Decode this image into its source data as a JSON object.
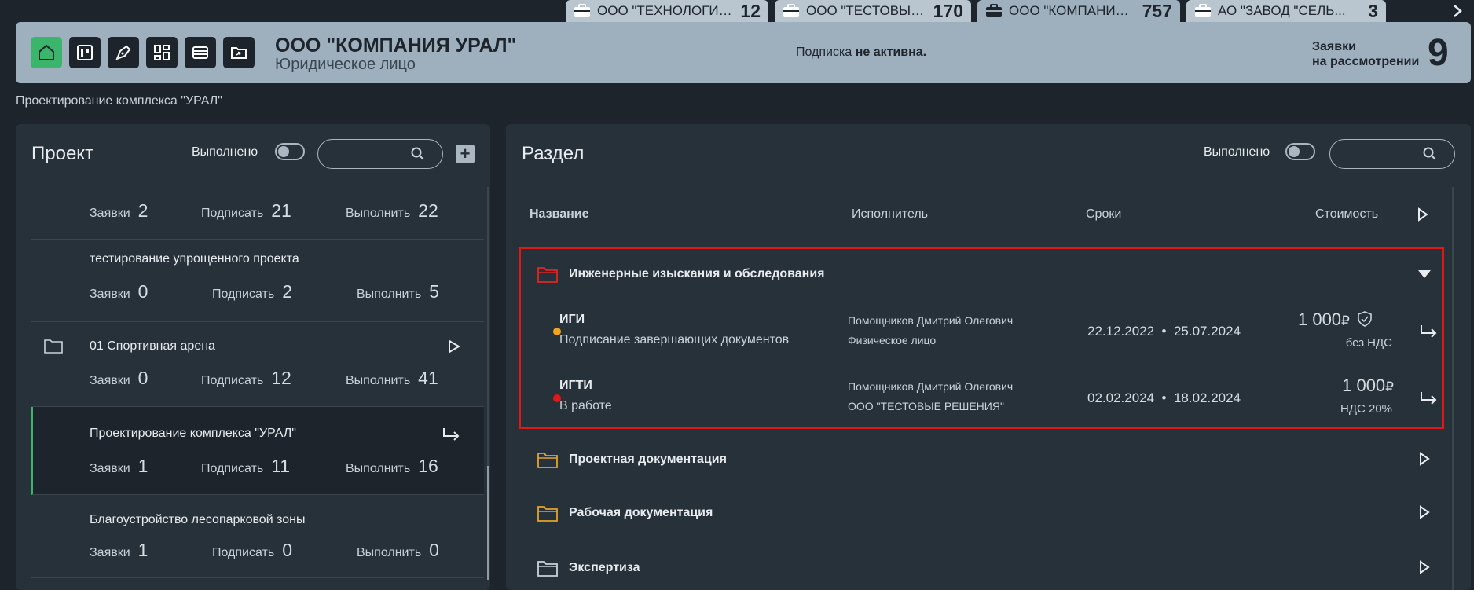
{
  "company_tabs": [
    {
      "name": "ООО \"ТЕХНОЛОГИЯ...",
      "count": "12",
      "active": false
    },
    {
      "name": "ООО \"ТЕСТОВЫЕ Р...",
      "count": "170",
      "active": false
    },
    {
      "name": "ООО \"КОМПАНИЯ У...",
      "count": "757",
      "active": true
    },
    {
      "name": "АО \"ЗАВОД \"СЕЛЬ...",
      "count": "3",
      "active": false
    }
  ],
  "header": {
    "company_name": "ООО \"КОМПАНИЯ УРАЛ\"",
    "company_type": "Юридическое лицо",
    "subscription_prefix": "Подписка ",
    "subscription_status": "не активна.",
    "requests_label_1": "Заявки",
    "requests_label_2": "на рассмотрении",
    "requests_count": "9"
  },
  "breadcrumb": "Проектирование комплекса \"УРАЛ\"",
  "left_panel": {
    "title": "Проект",
    "done_label": "Выполнено",
    "search_placeholder": "",
    "projects": [
      {
        "name": "",
        "requests": "2",
        "sign": "21",
        "execute": "22",
        "folder": false,
        "arrow": "",
        "selected": false
      },
      {
        "name": "тестирование упрощенного проекта",
        "requests": "0",
        "sign": "2",
        "execute": "5",
        "folder": false,
        "arrow": "",
        "selected": false
      },
      {
        "name": "01 Спортивная арена",
        "requests": "0",
        "sign": "12",
        "execute": "41",
        "folder": true,
        "arrow": "play",
        "selected": false
      },
      {
        "name": "Проектирование комплекса \"УРАЛ\"",
        "requests": "1",
        "sign": "11",
        "execute": "16",
        "folder": false,
        "arrow": "return",
        "selected": true
      },
      {
        "name": "Благоустройство лесопарковой зоны",
        "requests": "1",
        "sign": "0",
        "execute": "0",
        "folder": false,
        "arrow": "",
        "selected": false
      }
    ],
    "labels": {
      "requests": "Заявки",
      "sign": "Подписать",
      "execute": "Выполнить"
    }
  },
  "right_panel": {
    "title": "Раздел",
    "done_label": "Выполнено",
    "search_placeholder": "",
    "columns": {
      "name": "Название",
      "performer": "Исполнитель",
      "dates": "Сроки",
      "cost": "Стоимость"
    },
    "sections": [
      {
        "title": "Инженерные изыскания и обследования",
        "expanded": true,
        "folder_color": "#e02525"
      },
      {
        "title": "Проектная документация",
        "expanded": false,
        "folder_color": "#e6a32b"
      },
      {
        "title": "Рабочая документация",
        "expanded": false,
        "folder_color": "#e6a32b"
      },
      {
        "title": "Экспертиза",
        "expanded": false,
        "folder_color": "#c9d2d9"
      }
    ],
    "tasks": [
      {
        "title": "ИГИ",
        "status": "Подписание завершающих документов",
        "dot_color": "#f2a41f",
        "performer": "Помощников Дмитрий Олегович",
        "performer_org": "Физическое лицо",
        "start": "22.12.2022",
        "end": "25.07.2024",
        "cost": "1 000",
        "currency": "₽",
        "vat": "без НДС",
        "shield": true
      },
      {
        "title": "ИГТИ",
        "status": "В работе",
        "dot_color": "#e01818",
        "performer": "Помощников Дмитрий Олегович",
        "performer_org": "ООО \"ТЕСТОВЫЕ РЕШЕНИЯ\"",
        "start": "02.02.2024",
        "end": "18.02.2024",
        "cost": "1 000",
        "currency": "₽",
        "vat": "НДС 20%",
        "shield": false
      }
    ],
    "date_separator": "•"
  },
  "colors": {
    "accent_green": "#3ab56b",
    "header_bg": "#9eafbd",
    "panel_bg": "#27313a",
    "page_bg": "#1d242b",
    "highlight_red": "#e01818"
  }
}
